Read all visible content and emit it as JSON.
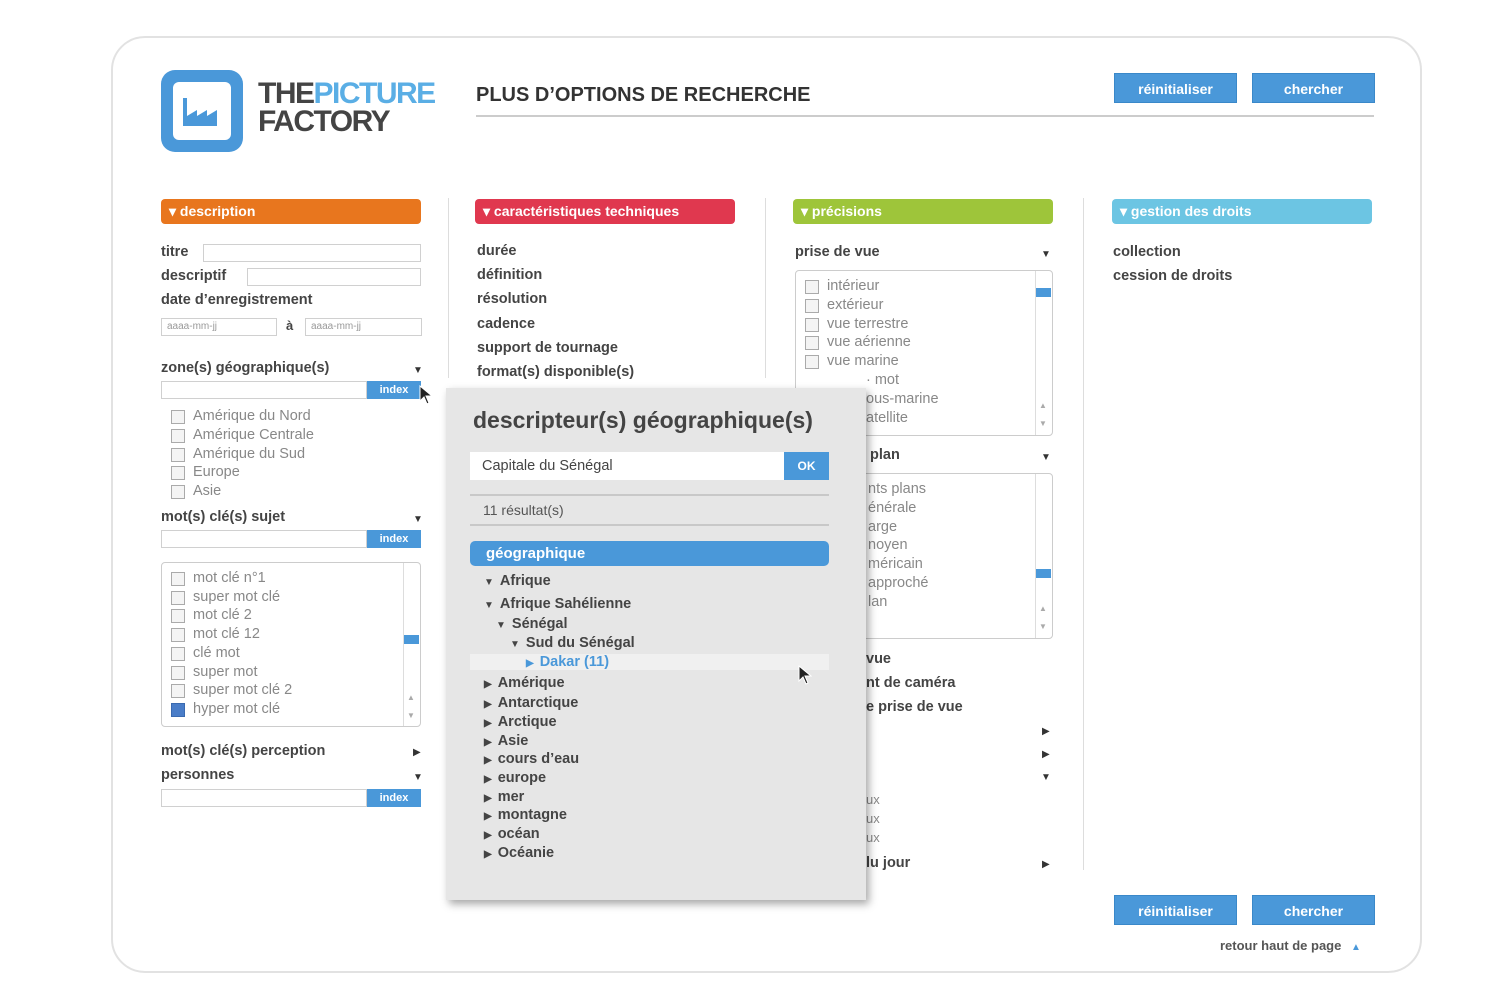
{
  "logo": {
    "the": "THE",
    "picture": "PICTURE",
    "factory": "FACTORY"
  },
  "page_title": "PLUS D’OPTIONS DE RECHERCHE",
  "buttons": {
    "reset": "réinitialiser",
    "search": "chercher",
    "back_to_top": "retour haut de page"
  },
  "colors": {
    "description": "#e8761e",
    "technique": "#e0384f",
    "precisions": "#9ec53a",
    "droits": "#6cc5e3",
    "accent": "#4a98d9"
  },
  "description": {
    "header": "▾ description",
    "titre": "titre",
    "descriptif": "descriptif",
    "date": "date d’enregistrement",
    "date_from_placeholder": "aaaa-mm-jj",
    "date_sep": "à",
    "date_to_placeholder": "aaaa-mm-jj",
    "zone": "zone(s) géographique(s)",
    "index": "index",
    "zones": [
      "Amérique du Nord",
      "Amérique Centrale",
      "Amérique du Sud",
      "Europe",
      "Asie"
    ],
    "motcle": "mot(s) clé(s) sujet",
    "keywords": [
      "mot clé n°1",
      "super mot clé",
      "mot clé 2",
      "mot clé 12",
      "clé mot",
      "super mot",
      "super mot clé 2",
      "hyper mot clé"
    ],
    "perception": "mot(s) clé(s) perception",
    "personnes": "personnes"
  },
  "technique": {
    "header": "▾ caractéristiques techniques",
    "items": [
      "durée",
      "définition",
      "résolution",
      "cadence",
      "support de tournage",
      "format(s) disponible(s)"
    ]
  },
  "precisions": {
    "header": "▾ précisions",
    "prise_de_vue": "prise de vue",
    "vue_options": [
      "intérieur",
      "extérieur",
      "vue terrestre",
      "vue aérienne",
      "vue marine"
    ],
    "vue_fragments": [
      "· mot",
      "ous-marine",
      "atellite"
    ],
    "plan": "plan",
    "plan_fragments": [
      "nts plans",
      "énérale",
      "arge",
      "noyen",
      "méricain",
      "approché",
      "lan"
    ],
    "items_fragments": [
      "vue",
      "nt de caméra",
      "e prise de vue"
    ],
    "ux_fragments": [
      "ux",
      "ux",
      "ux"
    ],
    "jour": "lu jour"
  },
  "droits": {
    "header": "▾ gestion des droits",
    "items": [
      "collection",
      "cession de droits"
    ]
  },
  "popup": {
    "title": "descripteur(s) géographique(s)",
    "query": "Capitale du Sénégal",
    "ok": "OK",
    "results": "11 résultat(s)",
    "category": "géographique",
    "tree": [
      {
        "label": "Afrique",
        "level": 0,
        "open": true
      },
      {
        "label": "Afrique Sahélienne",
        "level": 0,
        "open": true
      },
      {
        "label": "Sénégal",
        "level": 1,
        "open": true
      },
      {
        "label": "Sud du Sénégal",
        "level": 2,
        "open": true
      },
      {
        "label": "Dakar (11)",
        "level": 3,
        "open": false,
        "selected": true
      },
      {
        "label": "Amérique",
        "level": 0
      },
      {
        "label": "Antarctique",
        "level": 0
      },
      {
        "label": "Arctique",
        "level": 0
      },
      {
        "label": "Asie",
        "level": 0
      },
      {
        "label": "cours d’eau",
        "level": 0
      },
      {
        "label": "europe",
        "level": 0
      },
      {
        "label": "mer",
        "level": 0
      },
      {
        "label": "montagne",
        "level": 0
      },
      {
        "label": "océan",
        "level": 0
      },
      {
        "label": "Océanie",
        "level": 0
      }
    ]
  }
}
